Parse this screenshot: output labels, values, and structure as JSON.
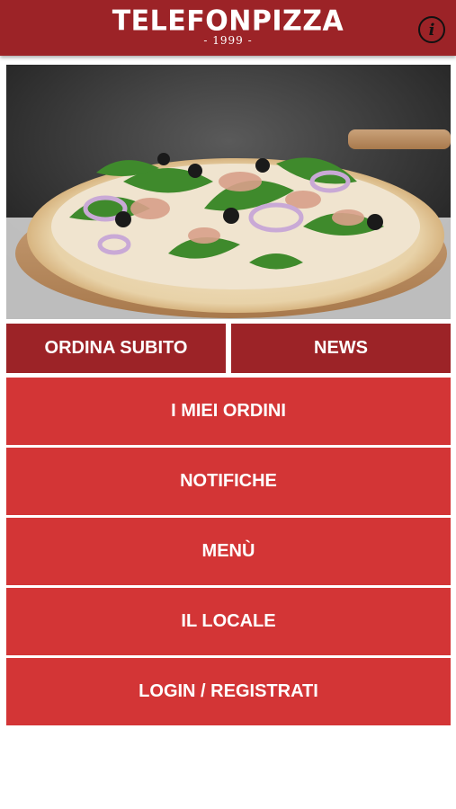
{
  "header": {
    "logo_title": "TELEFONPIZZA",
    "logo_year": "- 1999 -",
    "info_glyph": "i",
    "info_icon": "info-icon",
    "background_color": "#9c2327"
  },
  "hero": {
    "image_icon": "pizza-photo"
  },
  "actions": {
    "order_now": "ORDINA SUBITO",
    "news": "NEWS",
    "color": "#9c2327"
  },
  "menu": {
    "items": [
      {
        "label": "I MIEI ORDINI"
      },
      {
        "label": "NOTIFICHE"
      },
      {
        "label": "MENÙ"
      },
      {
        "label": "IL LOCALE"
      },
      {
        "label": "LOGIN / REGISTRATI"
      }
    ],
    "color": "#d33536"
  }
}
